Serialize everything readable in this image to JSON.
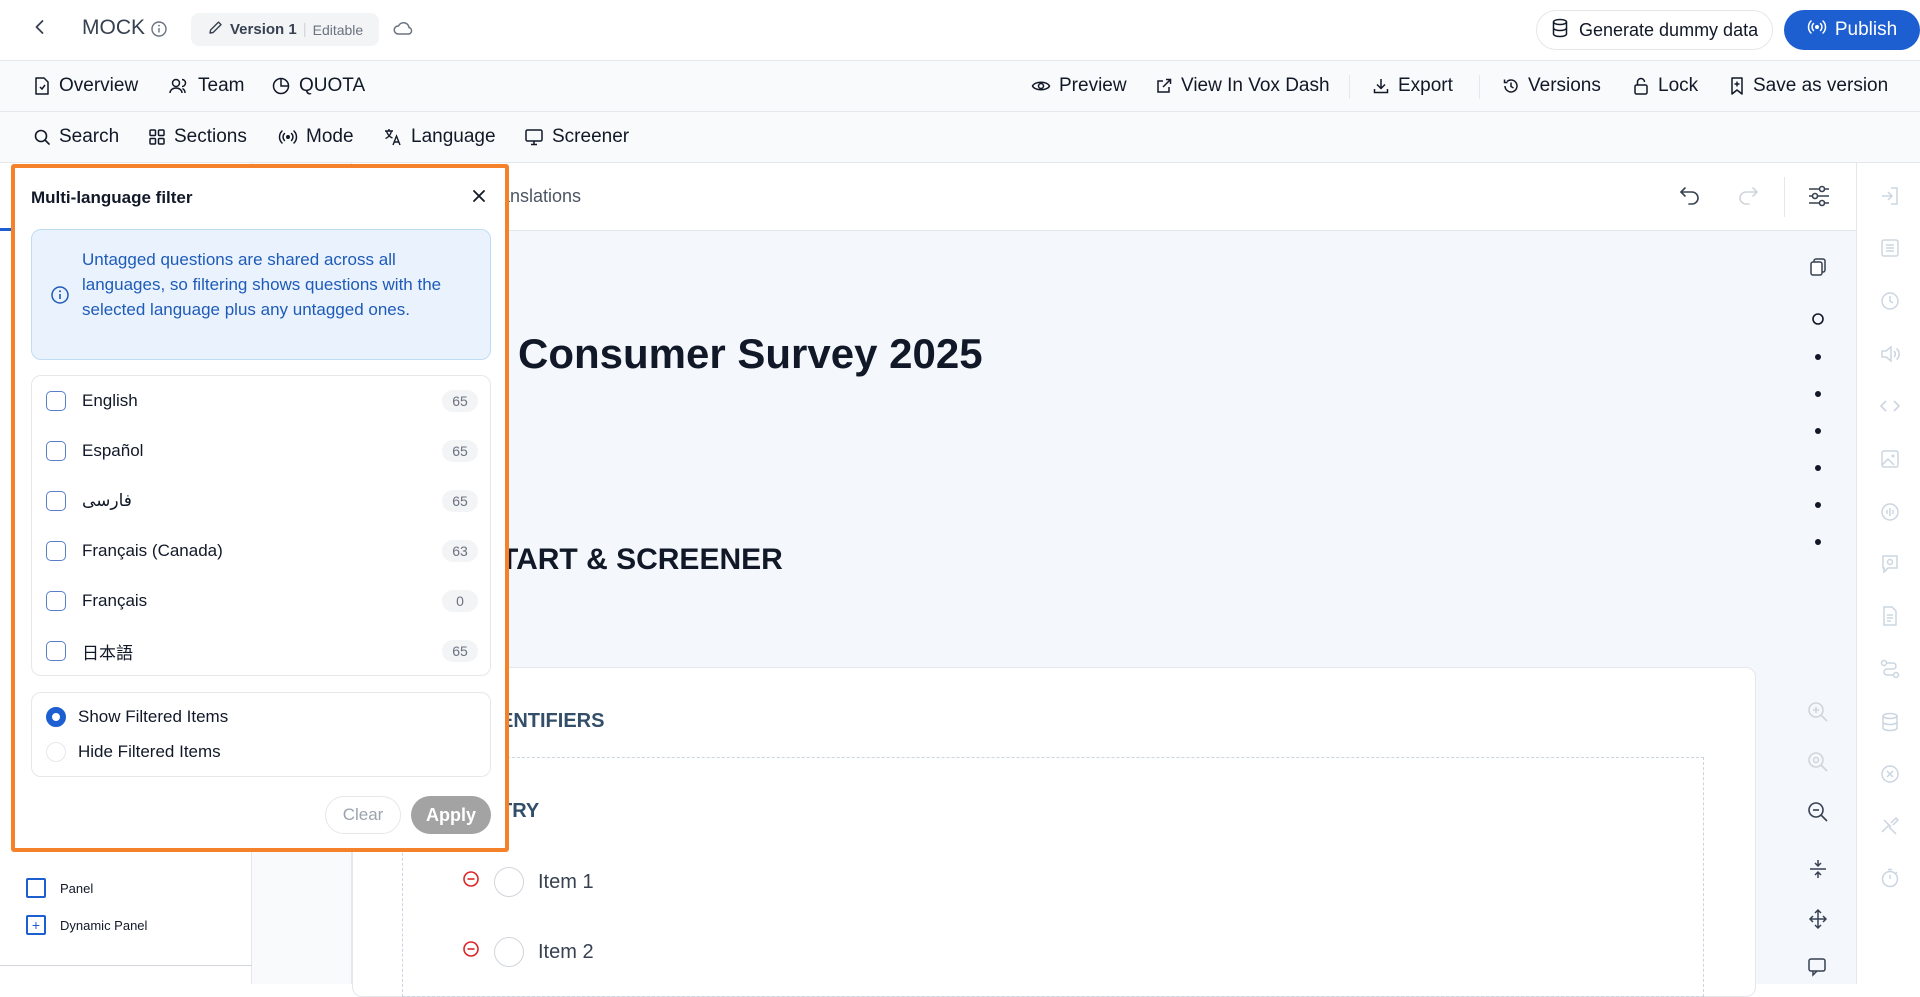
{
  "header": {
    "project_name": "MOCK",
    "version_label": "Version 1",
    "version_status": "Editable",
    "generate_label": "Generate dummy data",
    "publish_label": "Publish"
  },
  "nav_primary": {
    "left": [
      {
        "label": "Overview",
        "icon": "document-icon"
      },
      {
        "label": "Team",
        "icon": "users-icon"
      },
      {
        "label": "QUOTA",
        "icon": "pie-chart-icon"
      }
    ],
    "right": [
      {
        "label": "Preview",
        "icon": "eye-icon"
      },
      {
        "label": "View In Vox Dash",
        "icon": "external-link-icon"
      },
      {
        "label": "Export",
        "icon": "download-icon"
      },
      {
        "label": "Versions",
        "icon": "history-icon"
      },
      {
        "label": "Lock",
        "icon": "lock-icon"
      },
      {
        "label": "Save as version",
        "icon": "bookmark-icon"
      }
    ]
  },
  "nav_secondary": [
    {
      "label": "Search",
      "icon": "search-icon"
    },
    {
      "label": "Sections",
      "icon": "grid-icon"
    },
    {
      "label": "Mode",
      "icon": "broadcast-icon"
    },
    {
      "label": "Language",
      "icon": "translate-icon"
    },
    {
      "label": "Screener",
      "icon": "monitor-icon"
    }
  ],
  "canvas": {
    "tab_partial": "anslations",
    "survey_title": "Consumer Survey 2025",
    "section_title": "TART & SCREENER",
    "group_title": "ENTIFIERS",
    "question_title": "TRY",
    "items": [
      "Item 1",
      "Item 2"
    ]
  },
  "left_panel": {
    "items": [
      {
        "label": "Panel",
        "symbol": ""
      },
      {
        "label": "Dynamic Panel",
        "symbol": "+"
      }
    ]
  },
  "filter_popover": {
    "title": "Multi-language filter",
    "info": "Untagged questions are shared across all languages, so filtering shows questions with the selected language plus any untagged ones.",
    "languages": [
      {
        "name": "English",
        "count": "65"
      },
      {
        "name": "Español",
        "count": "65"
      },
      {
        "name": "فارسی",
        "count": "65"
      },
      {
        "name": "Français (Canada)",
        "count": "63"
      },
      {
        "name": "Français",
        "count": "0"
      },
      {
        "name": "日本語",
        "count": "65"
      }
    ],
    "modes": [
      {
        "label": "Show Filtered Items",
        "selected": true
      },
      {
        "label": "Hide Filtered Items",
        "selected": false
      }
    ],
    "clear_label": "Clear",
    "apply_label": "Apply"
  },
  "colors": {
    "accent": "#1d5fd1",
    "highlight_outline": "#f5822a",
    "info_bg": "#eaf3fd",
    "remove_red": "#dc2626"
  }
}
